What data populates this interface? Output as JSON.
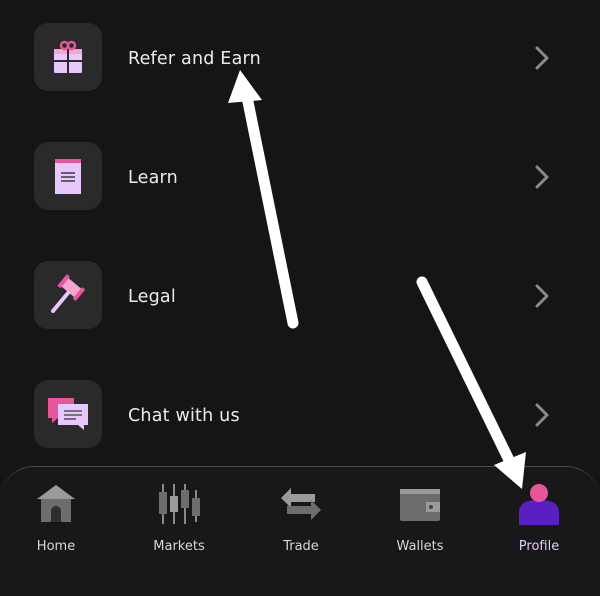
{
  "menu": {
    "items": [
      {
        "label": "Refer and Earn",
        "icon": "gift-icon"
      },
      {
        "label": "Learn",
        "icon": "notebook-icon"
      },
      {
        "label": "Legal",
        "icon": "gavel-icon"
      },
      {
        "label": "Chat with us",
        "icon": "chat-bubbles-icon"
      }
    ]
  },
  "nav": {
    "items": [
      {
        "label": "Home",
        "icon": "home-icon",
        "active": false
      },
      {
        "label": "Markets",
        "icon": "candlestick-icon",
        "active": false
      },
      {
        "label": "Trade",
        "icon": "swap-arrows-icon",
        "active": false
      },
      {
        "label": "Wallets",
        "icon": "wallet-icon",
        "active": false
      },
      {
        "label": "Profile",
        "icon": "profile-icon",
        "active": true
      }
    ]
  },
  "colors": {
    "background": "#151515",
    "tile": "#2a2a2a",
    "accent_pink": "#e8559a",
    "accent_lavender": "#e6c8ff",
    "accent_purple": "#5a1fc0",
    "icon_gray": "#6d6d6d"
  }
}
